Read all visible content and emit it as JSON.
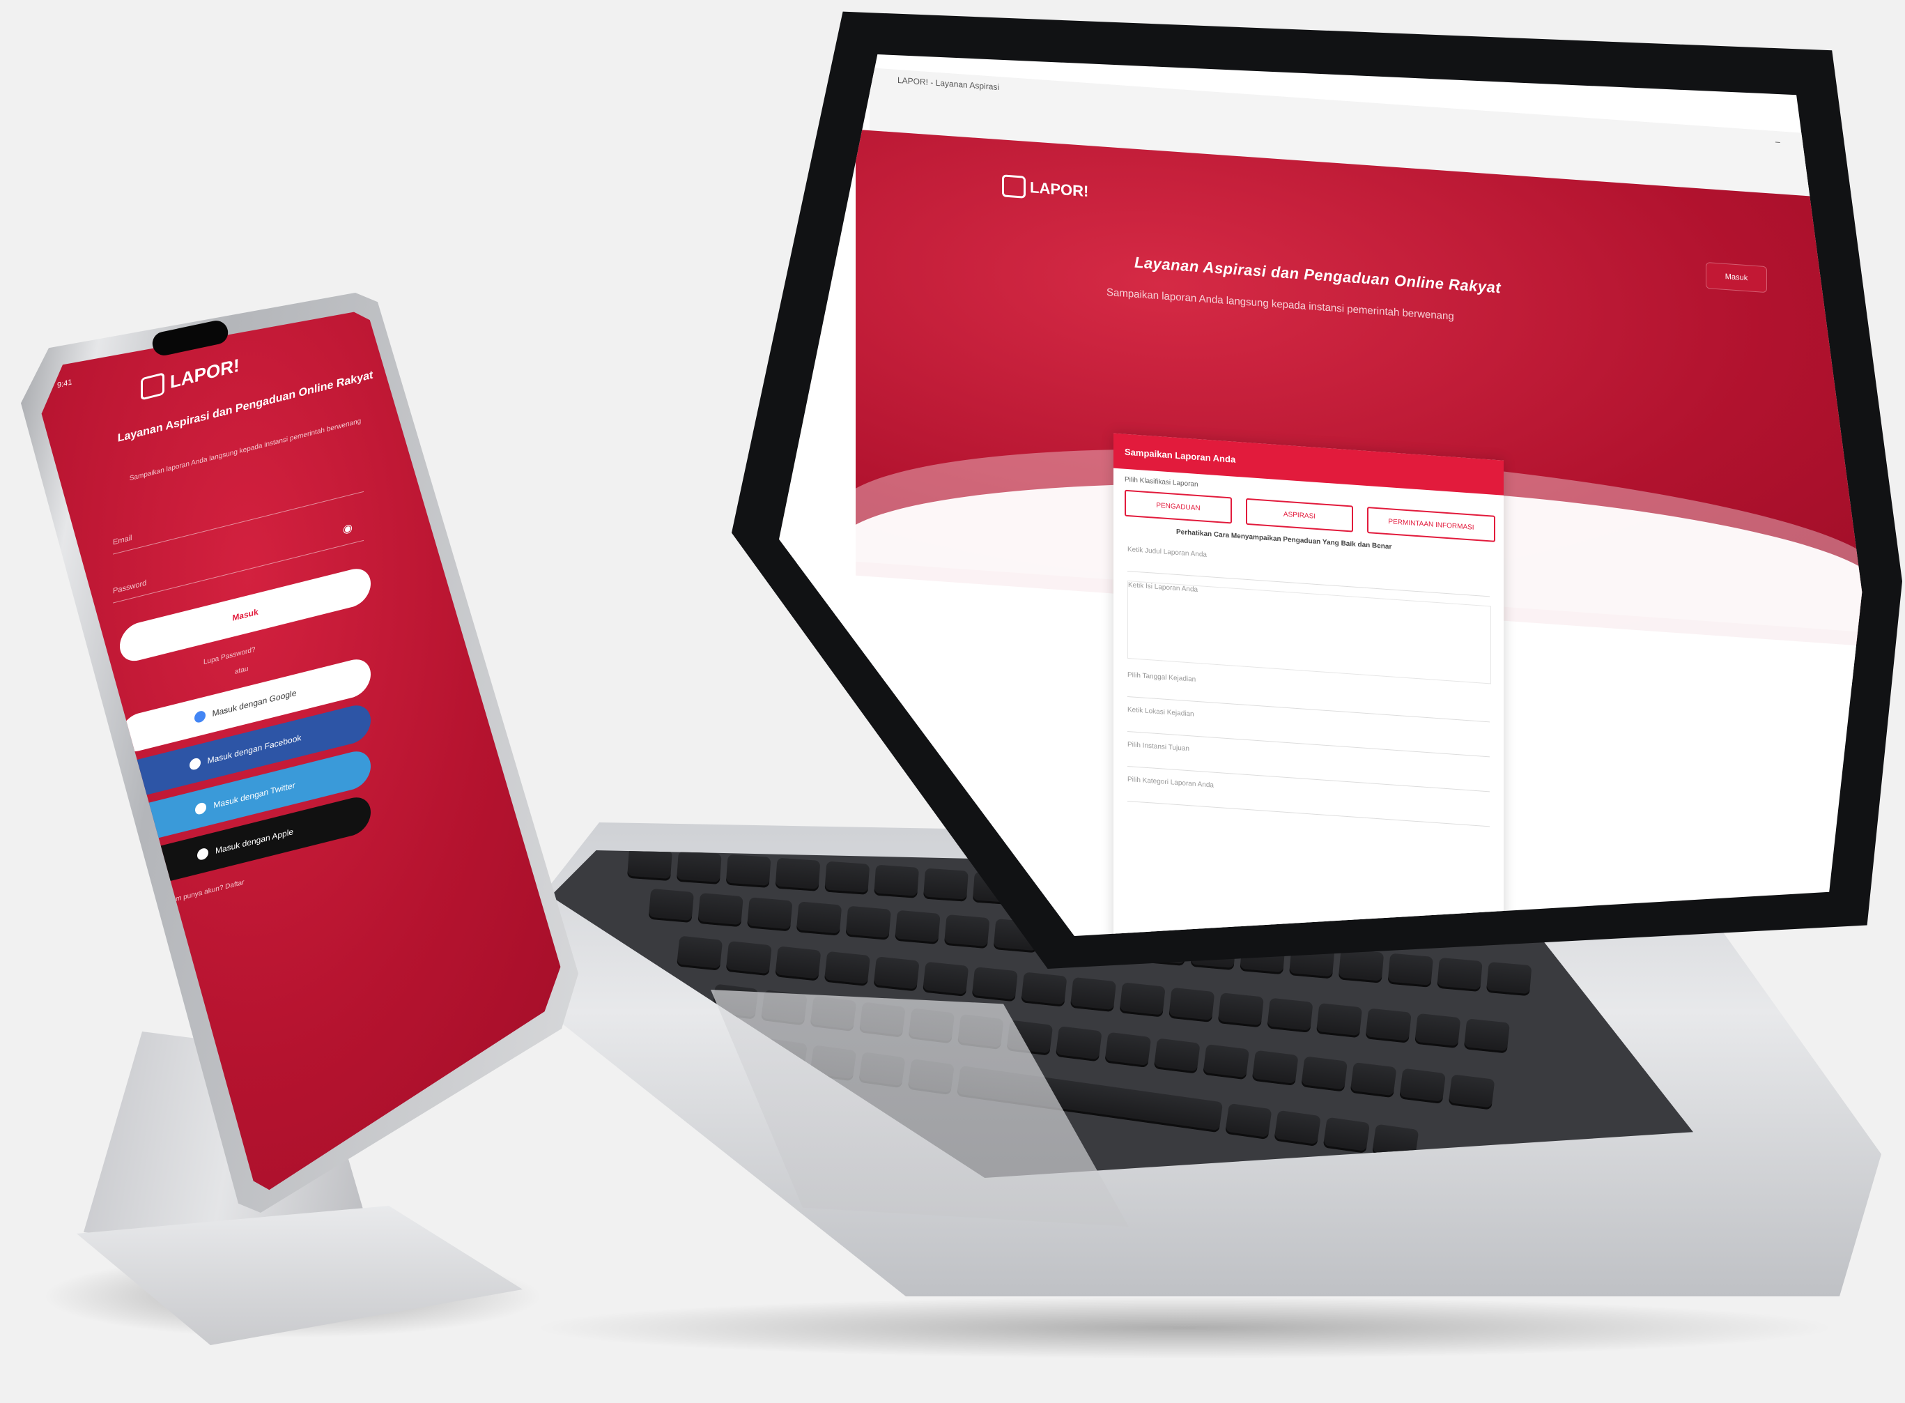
{
  "browser": {
    "tab_title": "LAPOR! - Layanan Aspirasi",
    "window_controls": [
      "–",
      "□",
      "✕"
    ]
  },
  "website": {
    "logo_text": "LAPOR!",
    "login_button": "Masuk",
    "hero_title": "Layanan Aspirasi dan Pengaduan Online Rakyat",
    "hero_subtitle": "Sampaikan laporan Anda langsung kepada instansi pemerintah berwenang",
    "form": {
      "header": "Sampaikan Laporan Anda",
      "category_label": "Pilih Klasifikasi Laporan",
      "categories": [
        "PENGADUAN",
        "ASPIRASI",
        "PERMINTAAN INFORMASI"
      ],
      "notice": "Perhatikan Cara Menyampaikan Pengaduan Yang Baik dan Benar",
      "fields": [
        "Ketik Judul Laporan Anda",
        "Ketik Isi Laporan Anda",
        "Pilih Tanggal Kejadian",
        "Ketik Lokasi Kejadian",
        "Pilih Instansi Tujuan",
        "Pilih Kategori Laporan Anda"
      ]
    }
  },
  "phone": {
    "status_time": "9:41",
    "logo_text": "LAPOR!",
    "title": "Layanan Aspirasi dan Pengaduan Online Rakyat",
    "subtitle": "Sampaikan laporan Anda langsung kepada instansi pemerintah berwenang",
    "email_placeholder": "Email",
    "password_placeholder": "Password",
    "login_button": "Masuk",
    "forgot_password": "Lupa Password?",
    "or_text": "atau",
    "social_buttons": [
      {
        "label": "Masuk dengan Google",
        "bg": "#ffffff",
        "fg": "#333333"
      },
      {
        "label": "Masuk dengan Facebook",
        "bg": "#2d55a6",
        "fg": "#ffffff"
      },
      {
        "label": "Masuk dengan Twitter",
        "bg": "#3a9ad9",
        "fg": "#ffffff"
      },
      {
        "label": "Masuk dengan Apple",
        "bg": "#111111",
        "fg": "#ffffff"
      }
    ],
    "register_text": "Belum punya akun? Daftar"
  },
  "colors": {
    "brand_red": "#e21b3c",
    "dark_red": "#a10d28"
  }
}
